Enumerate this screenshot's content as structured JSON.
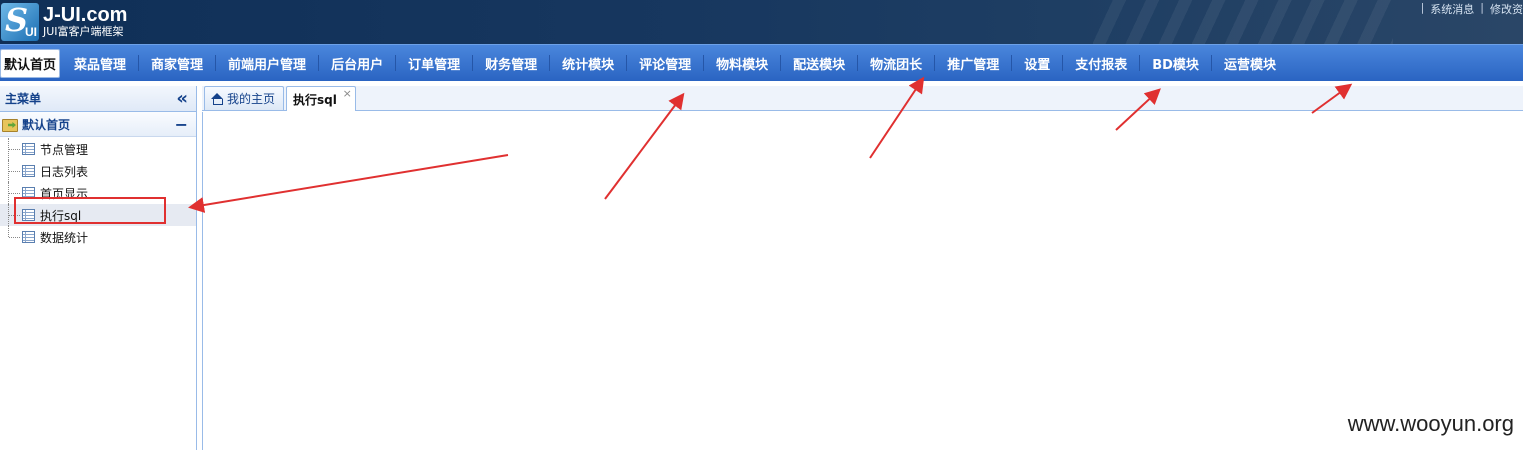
{
  "app": {
    "logo_title": "J-UI.com",
    "logo_subtitle": "JUI富客户端框架",
    "logo_mark_letter": "S",
    "logo_mark_text": "UI"
  },
  "top_links": [
    "系统消息",
    "修改资"
  ],
  "nav": {
    "items": [
      "默认首页",
      "菜品管理",
      "商家管理",
      "前端用户管理",
      "后台用户",
      "订单管理",
      "财务管理",
      "统计模块",
      "评论管理",
      "物料模块",
      "配送模块",
      "物流团长",
      "推广管理",
      "设置",
      "支付报表",
      "BD模块",
      "运营模块"
    ],
    "active_index": 0
  },
  "sidebar": {
    "title": "主菜单",
    "collapse_symbol": "«",
    "group_title": "默认首页",
    "group_toggle": "−",
    "items": [
      "节点管理",
      "日志列表",
      "首页显示",
      "执行sql",
      "数据统计"
    ],
    "selected_index": 3
  },
  "tabs": [
    {
      "label": "我的主页",
      "icon": "home-icon",
      "active": false
    },
    {
      "label": "执行sql",
      "icon": null,
      "active": true,
      "close_symbol": "×"
    }
  ],
  "watermark": "www.wooyun.org",
  "colors": {
    "header_bg": "#17375f",
    "nav_bg": "#2f6bc8",
    "annotation_red": "#e03030",
    "border": "#99bbe8"
  }
}
